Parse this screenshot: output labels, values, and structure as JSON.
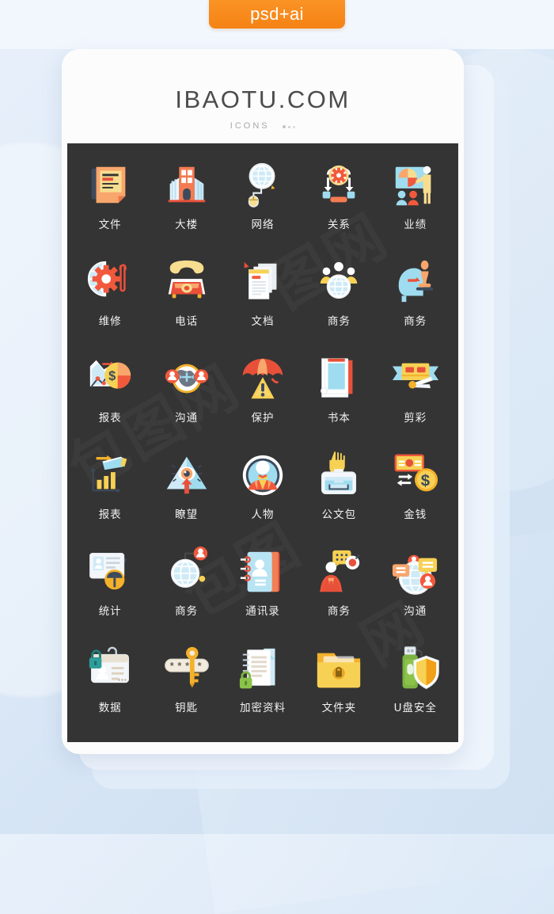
{
  "badge": {
    "label": "psd+ai",
    "color": "#f58214"
  },
  "card": {
    "title": "IBAOTU.COM",
    "subtitle": "ICONS"
  },
  "panel": {
    "background": "#343434",
    "watermarks": [
      "包图网",
      "图网",
      "包图",
      "网"
    ]
  },
  "icons": [
    {
      "id": "file",
      "label": "文件",
      "glyph": "file-note-icon"
    },
    {
      "id": "building",
      "label": "大楼",
      "glyph": "office-building-icon"
    },
    {
      "id": "network",
      "label": "网络",
      "glyph": "globe-mouse-icon"
    },
    {
      "id": "relation",
      "label": "关系",
      "glyph": "gear-workflow-icon"
    },
    {
      "id": "performance",
      "label": "业绩",
      "glyph": "presentation-chart-icon"
    },
    {
      "id": "maintenance",
      "label": "维修",
      "glyph": "gear-wrench-icon"
    },
    {
      "id": "telephone",
      "label": "电话",
      "glyph": "desk-phone-icon"
    },
    {
      "id": "document",
      "label": "文档",
      "glyph": "documents-icon"
    },
    {
      "id": "business-team",
      "label": "商务",
      "glyph": "team-globe-icon"
    },
    {
      "id": "business-chess",
      "label": "商务",
      "glyph": "head-chess-icon"
    },
    {
      "id": "report-pie",
      "label": "报表",
      "glyph": "chart-pie-dollar-icon"
    },
    {
      "id": "communicate",
      "label": "沟通",
      "glyph": "globe-users-icon"
    },
    {
      "id": "protect",
      "label": "保护",
      "glyph": "umbrella-warning-icon"
    },
    {
      "id": "book",
      "label": "书本",
      "glyph": "open-book-icon"
    },
    {
      "id": "ribbon-cutting",
      "label": "剪彩",
      "glyph": "ribbon-scissors-icon"
    },
    {
      "id": "report-scope",
      "label": "报表",
      "glyph": "telescope-bars-icon"
    },
    {
      "id": "lookout",
      "label": "瞭望",
      "glyph": "eye-triangle-icon"
    },
    {
      "id": "person",
      "label": "人物",
      "glyph": "avatar-circle-icon"
    },
    {
      "id": "briefcase",
      "label": "公文包",
      "glyph": "hand-briefcase-icon"
    },
    {
      "id": "money",
      "label": "金钱",
      "glyph": "banknote-coin-icon"
    },
    {
      "id": "statistics",
      "label": "统计",
      "glyph": "id-card-umbrella-icon"
    },
    {
      "id": "business-globe",
      "label": "商务",
      "glyph": "globe-node-icon"
    },
    {
      "id": "contacts",
      "label": "通讯录",
      "glyph": "address-book-icon"
    },
    {
      "id": "business-talk",
      "label": "商务",
      "glyph": "people-chat-icon"
    },
    {
      "id": "communication",
      "label": "沟通",
      "glyph": "globe-chat-icon"
    },
    {
      "id": "data",
      "label": "数据",
      "glyph": "id-card-lock-icon"
    },
    {
      "id": "key",
      "label": "钥匙",
      "glyph": "password-key-icon"
    },
    {
      "id": "encrypted-doc",
      "label": "加密资料",
      "glyph": "locked-notebook-icon"
    },
    {
      "id": "folder",
      "label": "文件夹",
      "glyph": "secure-folder-icon"
    },
    {
      "id": "usb-security",
      "label": "U盘安全",
      "glyph": "usb-shield-icon"
    }
  ],
  "palette": {
    "orange": "#f47b52",
    "red": "#e8503a",
    "yellow": "#f7d154",
    "blue": "#aee0f2",
    "light_blue": "#cfeaf7",
    "white": "#ffffff",
    "dark": "#343434",
    "gold": "#f4b12a"
  }
}
